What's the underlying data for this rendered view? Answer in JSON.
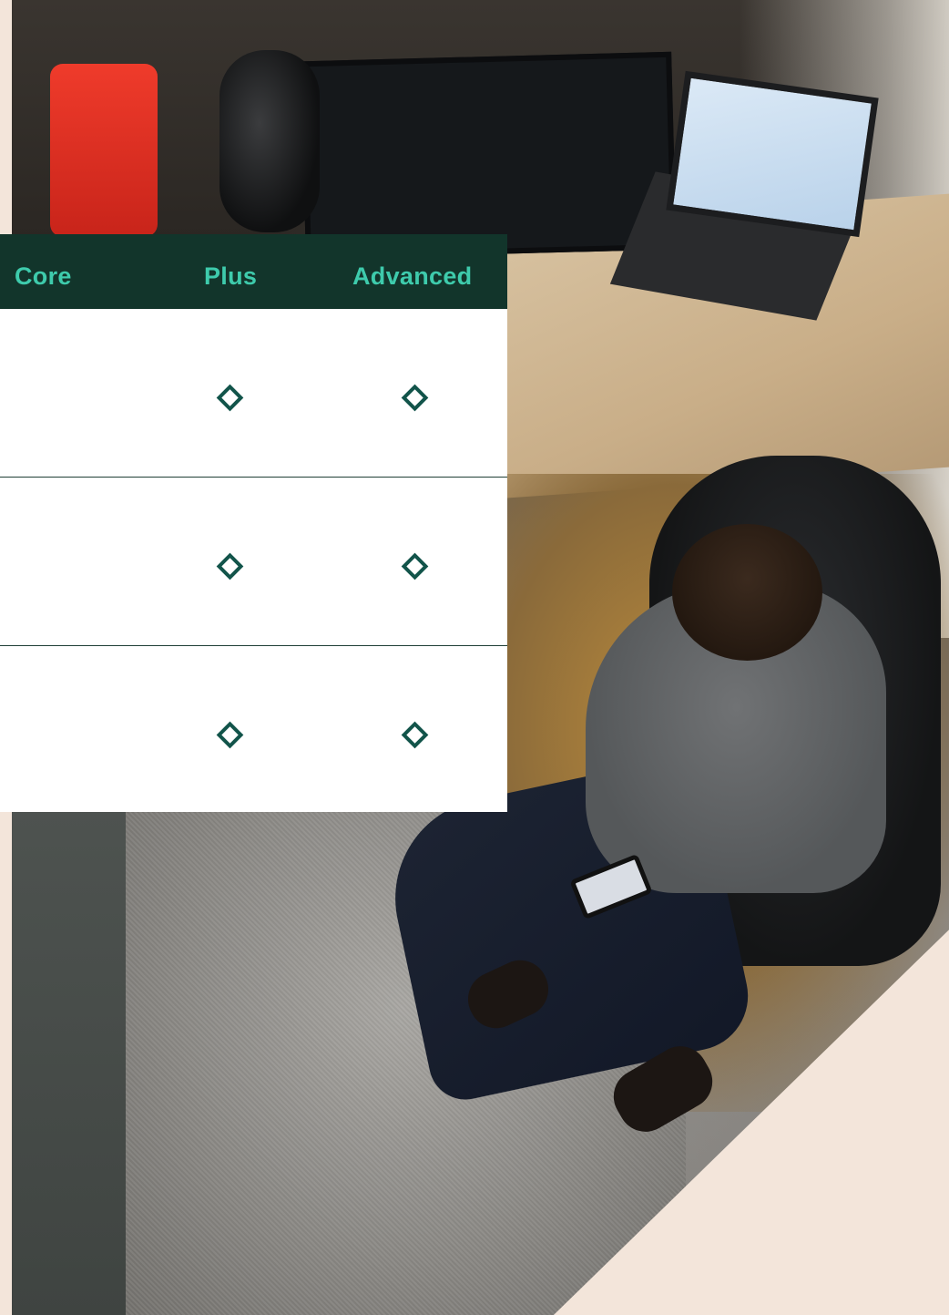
{
  "columns": {
    "core": "Core",
    "plus": "Plus",
    "advanced": "Advanced"
  },
  "rows": [
    {
      "core": false,
      "plus": true,
      "advanced": true
    },
    {
      "core": false,
      "plus": true,
      "advanced": true
    },
    {
      "core": false,
      "plus": true,
      "advanced": true
    }
  ],
  "colors": {
    "header_background": "#12352b",
    "header_text": "#3ecbac",
    "check_mark": "#12544a",
    "page_background": "#f3e5da"
  },
  "icons": {
    "included": "diamond-check-icon"
  }
}
